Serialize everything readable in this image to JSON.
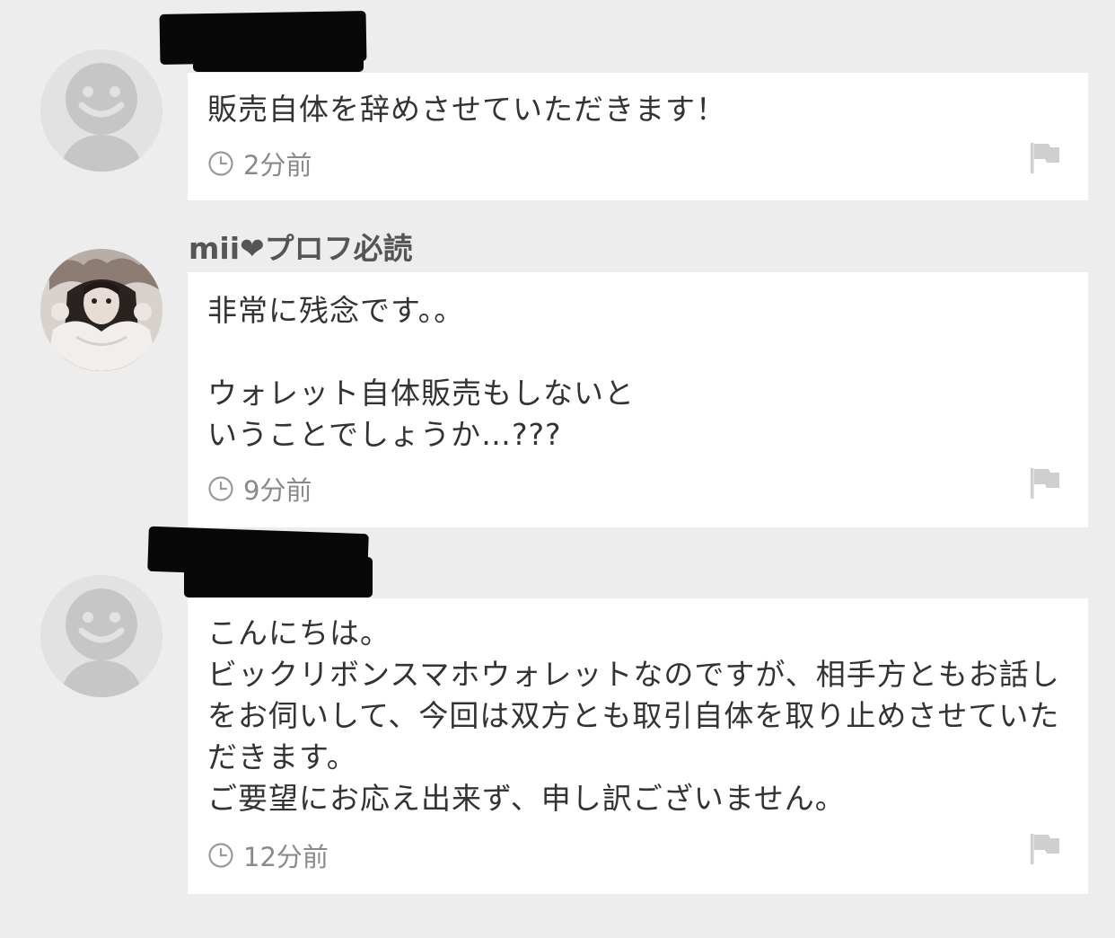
{
  "comments": [
    {
      "username": "",
      "text": "販売自体を辞めさせていただきます！",
      "time": "2分前"
    },
    {
      "username": "mii❤︎プロフ必読",
      "text": "非常に残念です。。\n\nウォレット自体販売もしないと\nいうことでしょうか…???",
      "time": "9分前"
    },
    {
      "username": "",
      "text": "こんにちは。\nビックリボンスマホウォレットなのですが、相手方ともお話しをお伺いして、今回は双方とも取引自体を取り止めさせていただきます。\nご要望にお応え出来ず、申し訳ございません。",
      "time": "12分前"
    }
  ],
  "icons": {
    "clock": "clock-icon",
    "flag": "flag-icon",
    "default_avatar": "default-avatar-icon"
  },
  "colors": {
    "background": "#ededed",
    "bubble": "#ffffff",
    "text": "#333333",
    "muted": "#8a8a8a"
  }
}
